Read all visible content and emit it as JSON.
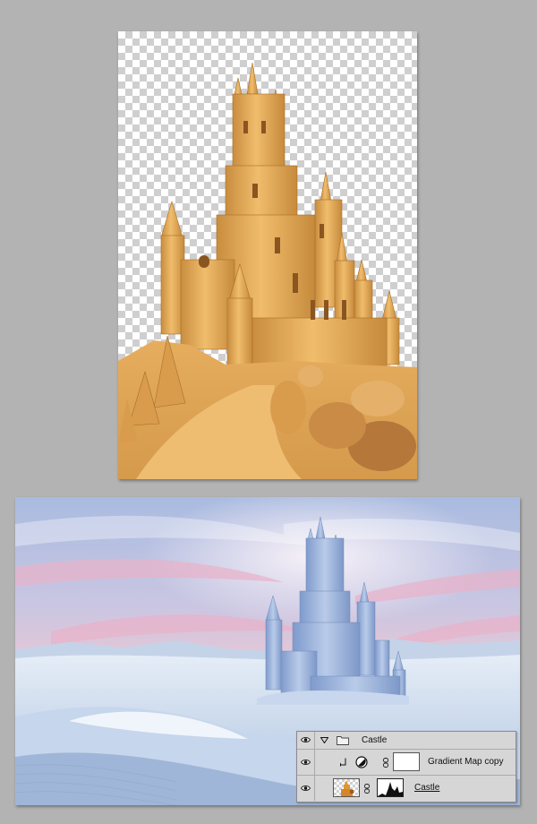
{
  "layers_panel": {
    "layers": [
      {
        "name": "Castle",
        "kind": "group",
        "visible": true,
        "expanded": true
      },
      {
        "name": "Gradient Map copy",
        "kind": "adjustment",
        "visible": true,
        "clipped": true
      },
      {
        "name": "Castle",
        "kind": "pixel-with-mask",
        "visible": true
      }
    ]
  },
  "icons": {
    "visibility": "eye-icon",
    "expand": "triangle-down-icon",
    "group": "folder-icon",
    "clip": "clipping-arrow-icon",
    "adjustment": "adjustment-circle-icon",
    "link": "chain-link-icon"
  },
  "colors": {
    "workspace": "#b3b3b3",
    "sand": "#e2a95c",
    "sky_blue": "#9fb6dc",
    "sky_pink": "#e9b3c8",
    "snow": "#dfe8f4"
  }
}
